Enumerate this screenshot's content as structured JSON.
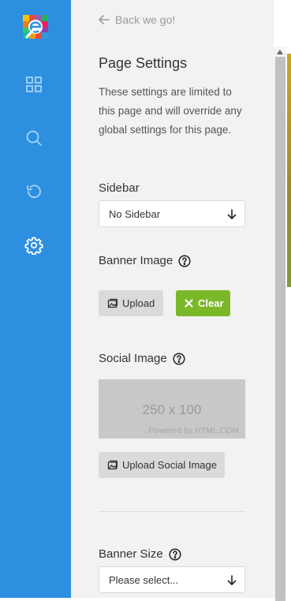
{
  "rail": {
    "logo_icon": "editor-logo-icon",
    "items": [
      {
        "icon": "grid-icon",
        "name": "blocks"
      },
      {
        "icon": "search-icon",
        "name": "search"
      },
      {
        "icon": "history-icon",
        "name": "history"
      },
      {
        "icon": "gear-icon",
        "name": "settings"
      }
    ],
    "background": "#2d8fe0"
  },
  "panel": {
    "back_label": "Back we go!",
    "title": "Page Settings",
    "description": "These settings are limited to this page and will override any global settings for this page.",
    "sidebar": {
      "label": "Sidebar",
      "selected": "No Sidebar"
    },
    "banner_image": {
      "label": "Banner Image",
      "upload_label": "Upload",
      "clear_label": "Clear"
    },
    "social_image": {
      "label": "Social Image",
      "placeholder_dims": "250 x 100",
      "placeholder_credit": "Powered by HTML.COM",
      "upload_label": "Upload Social Image"
    },
    "banner_size": {
      "label": "Banner Size",
      "selected": "Please select..."
    }
  },
  "colors": {
    "accent_blue": "#2d8fe0",
    "clear_green": "#7ab829",
    "panel_bg": "#f2f2f2"
  }
}
